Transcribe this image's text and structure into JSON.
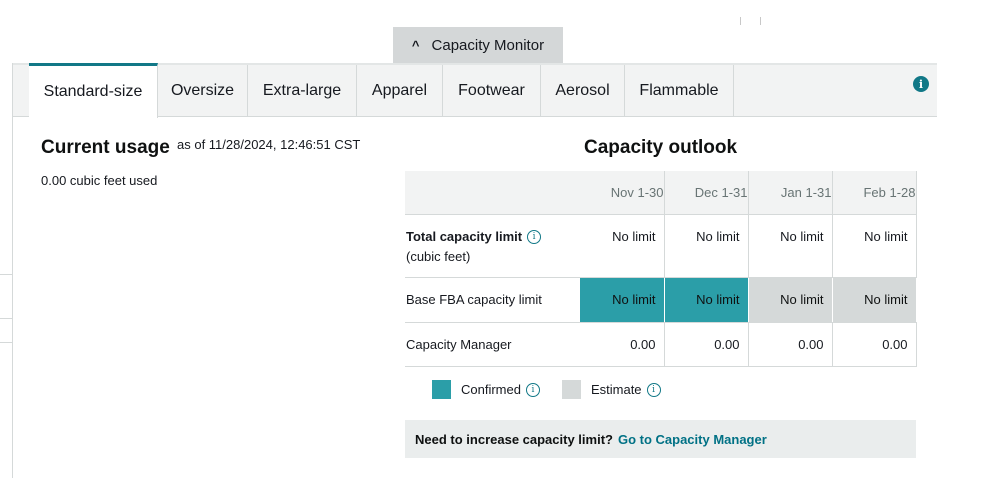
{
  "monitor_tab": {
    "label": "Capacity Monitor",
    "chevron": "^"
  },
  "tabs": [
    {
      "label": "Standard-size",
      "active": true
    },
    {
      "label": "Oversize"
    },
    {
      "label": "Extra-large"
    },
    {
      "label": "Apparel"
    },
    {
      "label": "Footwear"
    },
    {
      "label": "Aerosol"
    },
    {
      "label": "Flammable"
    }
  ],
  "current_usage": {
    "title": "Current usage",
    "as_of": "as of 11/28/2024, 12:46:51 CST",
    "used": "0.00 cubic feet used"
  },
  "outlook": {
    "title": "Capacity outlook",
    "columns": [
      "Nov 1-30",
      "Dec 1-31",
      "Jan 1-31",
      "Feb 1-28"
    ],
    "rows": {
      "total": {
        "label": "Total capacity limit",
        "sublabel": "(cubic feet)",
        "values": [
          "No limit",
          "No limit",
          "No limit",
          "No limit"
        ]
      },
      "base": {
        "label": "Base FBA capacity limit",
        "values": [
          "No limit",
          "No limit",
          "No limit",
          "No limit"
        ],
        "status": [
          "confirmed",
          "confirmed",
          "estimate",
          "estimate"
        ]
      },
      "manager": {
        "label": "Capacity Manager",
        "values": [
          "0.00",
          "0.00",
          "0.00",
          "0.00"
        ]
      }
    }
  },
  "legend": {
    "confirmed": "Confirmed",
    "estimate": "Estimate"
  },
  "cta": {
    "question": "Need to increase capacity limit?",
    "link": "Go to Capacity Manager"
  },
  "colors": {
    "accent": "#117887",
    "confirmed": "#2b9ea8",
    "estimate": "#d5d9d9"
  },
  "icons": {
    "info_filled": "info-icon",
    "info_outline": "info-circle-icon",
    "chevron": "chevron-up-icon"
  }
}
